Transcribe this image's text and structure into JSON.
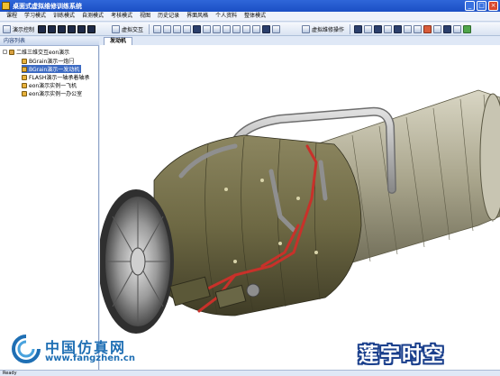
{
  "window": {
    "title": "桌面式虚拟维修训练系统",
    "buttons": [
      "_",
      "□",
      "×"
    ]
  },
  "menu": [
    "课程",
    "学习模式",
    "训练模式",
    "自测模式",
    "考核模式",
    "视图",
    "历史记录",
    "界面风格",
    "个人资料",
    "整体模式"
  ],
  "toolbar": {
    "demo_label": "演示控制",
    "virtual_label": "虚拟交互",
    "maintenance_label": "虚拟维修操作"
  },
  "left_panel": {
    "header": "内容列表",
    "tree": {
      "root": "二维三维交互eon演示",
      "items": [
        {
          "label": "BGrain演示一炮闩",
          "selected": false
        },
        {
          "label": "BGrain演示一发动机",
          "selected": true
        },
        {
          "label": "FLASH演示一轴承着轴承",
          "selected": false
        },
        {
          "label": "eon演示实例一飞机",
          "selected": false
        },
        {
          "label": "eon演示实例一办公室",
          "selected": false
        }
      ]
    }
  },
  "tabs": {
    "active": "发动机"
  },
  "status": {
    "text": "Ready"
  },
  "watermarks": {
    "left_cn": "中国仿真网",
    "left_url": "www.fangzhen.cn",
    "right": "莲宇时空"
  },
  "colors": {
    "titlebar": "#1b4fc4",
    "selection": "#3d6bc3",
    "engine_body": "#6f6a45",
    "pipes_red": "#c8312a",
    "pipes_gray": "#b9b9b9"
  }
}
